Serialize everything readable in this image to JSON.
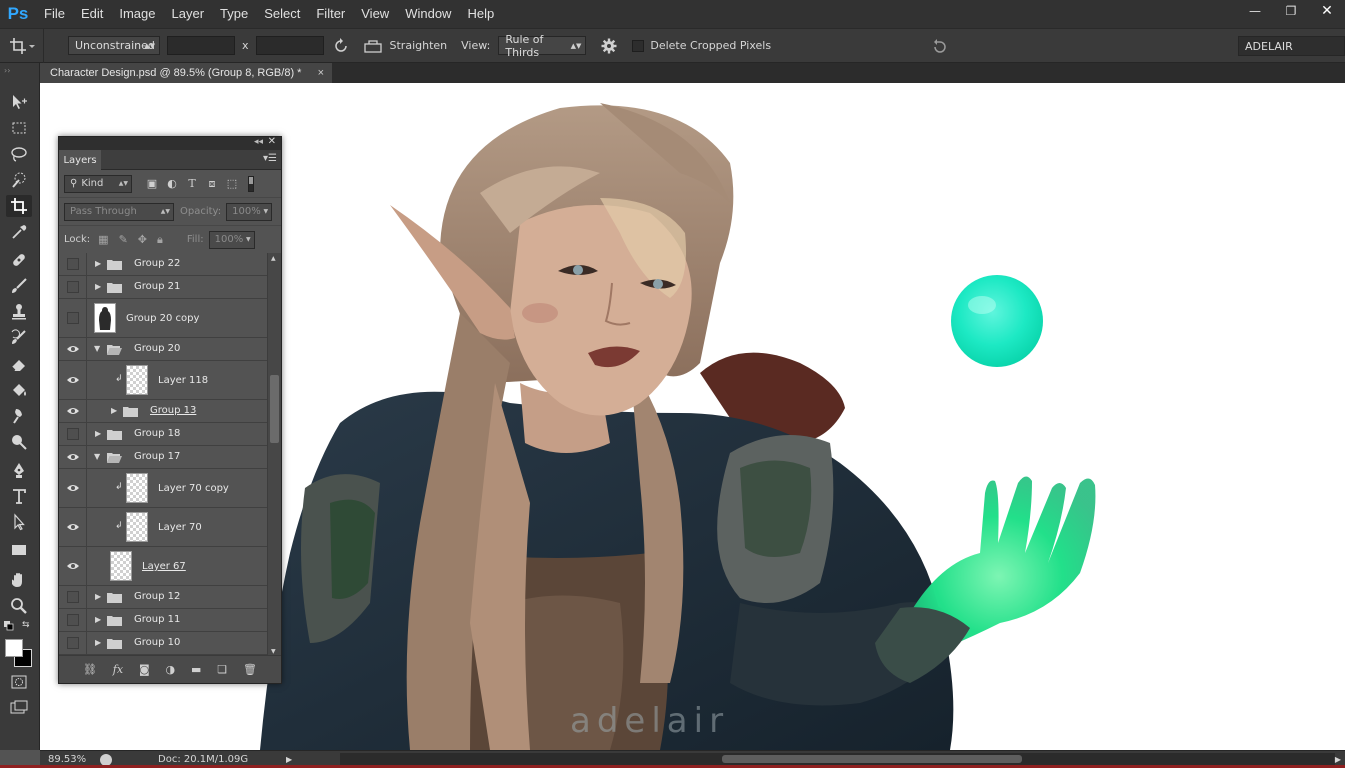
{
  "menubar": {
    "logo": "Ps",
    "items": [
      "File",
      "Edit",
      "Image",
      "Layer",
      "Type",
      "Select",
      "Filter",
      "View",
      "Window",
      "Help"
    ]
  },
  "window_controls": {
    "minimize": "—",
    "restore": "❐",
    "close": "✕"
  },
  "options": {
    "ratio": "Unconstrained",
    "x_sep": "x",
    "straighten": "Straighten",
    "view_label": "View:",
    "view_value": "Rule of Thirds",
    "delete_cropped": "Delete Cropped Pixels",
    "workspace": "ADELAIR"
  },
  "document": {
    "tab": "Character Design.psd @ 89.5% (Group 8, RGB/8) *",
    "close": "×",
    "watermark": "adelair"
  },
  "layers_panel": {
    "tab": "Layers",
    "filter_kind": "Kind",
    "blend_mode": "Pass Through",
    "opacity_label": "Opacity:",
    "opacity_value": "100%",
    "lock_label": "Lock:",
    "fill_label": "Fill:",
    "fill_value": "100%",
    "layers": [
      {
        "name": "Group 22",
        "type": "group",
        "visible": false,
        "expanded": false,
        "indent": 0
      },
      {
        "name": "Group 21",
        "type": "group",
        "visible": false,
        "expanded": false,
        "indent": 0
      },
      {
        "name": "Group 20 copy",
        "type": "layer-figure",
        "visible": false,
        "indent": 0
      },
      {
        "name": "Group 20",
        "type": "group",
        "visible": true,
        "expanded": true,
        "indent": 0
      },
      {
        "name": "Layer 118",
        "type": "layer",
        "visible": true,
        "clipped": true,
        "indent": 1
      },
      {
        "name": "Group 13",
        "type": "group",
        "visible": true,
        "expanded": false,
        "indent": 1,
        "underline": true
      },
      {
        "name": "Group 18",
        "type": "group",
        "visible": false,
        "expanded": false,
        "indent": 0
      },
      {
        "name": "Group 17",
        "type": "group",
        "visible": true,
        "expanded": true,
        "indent": 0
      },
      {
        "name": "Layer 70 copy",
        "type": "layer",
        "visible": true,
        "clipped": true,
        "indent": 1
      },
      {
        "name": "Layer 70",
        "type": "layer",
        "visible": true,
        "clipped": true,
        "indent": 1
      },
      {
        "name": "Layer 67",
        "type": "layer",
        "visible": true,
        "indent": 1,
        "underline": true
      },
      {
        "name": "Group 12",
        "type": "group",
        "visible": false,
        "expanded": false,
        "indent": 0
      },
      {
        "name": "Group 11",
        "type": "group",
        "visible": false,
        "expanded": false,
        "indent": 0
      },
      {
        "name": "Group 10",
        "type": "group",
        "visible": false,
        "expanded": false,
        "indent": 0
      }
    ]
  },
  "status": {
    "zoom": "89.53%",
    "doc": "Doc: 20.1M/1.09G"
  },
  "colors": {
    "accent": "#31a8ff",
    "orb": "#1de9c4",
    "hand_glow": "#22e08a"
  }
}
